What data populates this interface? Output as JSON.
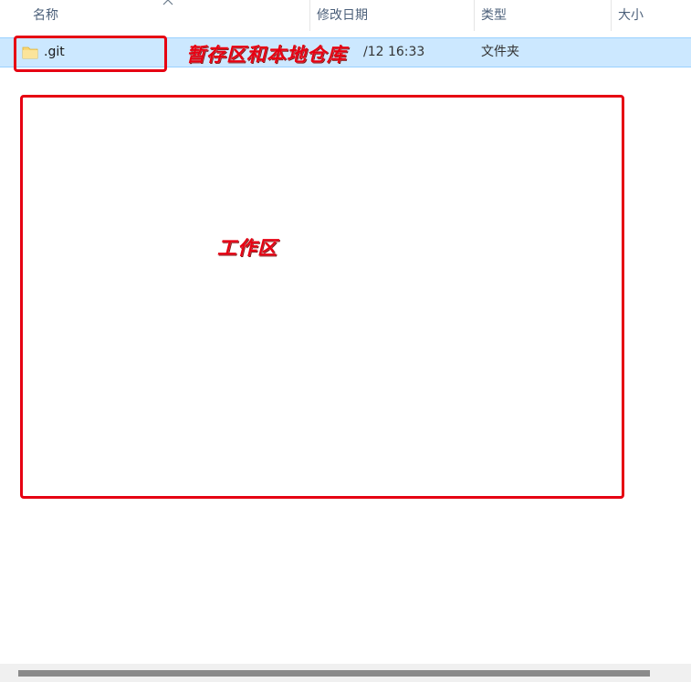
{
  "columns": {
    "name": "名称",
    "modified": "修改日期",
    "type": "类型",
    "size": "大小"
  },
  "rows": [
    {
      "name": ".git",
      "modified_visible": "/12 16:33",
      "type": "文件夹",
      "icon": "folder-icon"
    }
  ],
  "annotations": {
    "staging_label": "暂存区和本地仓库",
    "workspace_label": "工作区",
    "color": "#e60012"
  },
  "colors": {
    "selection_bg": "#cce8ff",
    "selection_border": "#99d1ff",
    "header_text": "#4c607a"
  }
}
